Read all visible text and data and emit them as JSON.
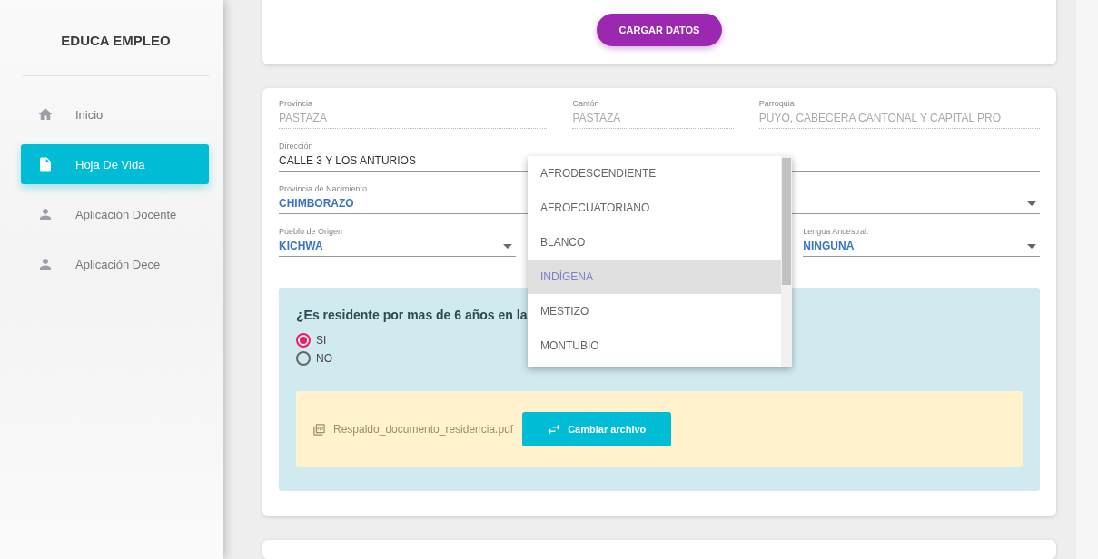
{
  "sidebar": {
    "title": "EDUCA EMPLEO",
    "items": [
      {
        "label": "Inicio",
        "kind": "home",
        "selected": false
      },
      {
        "label": "Hoja De Vida",
        "kind": "file",
        "selected": true
      },
      {
        "label": "Aplicación Docente",
        "kind": "person",
        "selected": false
      },
      {
        "label": "Aplicación Dece",
        "kind": "person",
        "selected": false
      }
    ]
  },
  "top_card": {
    "button": "CARGAR DATOS"
  },
  "form": {
    "rows": [
      [
        {
          "label": "Provincia",
          "value": "PASTAZA",
          "kind": "text",
          "disabled": true
        },
        {
          "label": "Cantón",
          "value": "PASTAZA",
          "kind": "text",
          "disabled": true
        },
        {
          "label": "Parroquia",
          "value": "PUYO, CABECERA CANTONAL Y CAPITAL PRO",
          "kind": "text",
          "disabled": true
        }
      ],
      [
        {
          "label": "Dirección",
          "value": "CALLE 3 Y LOS ANTURIOS",
          "kind": "text",
          "disabled": false
        }
      ],
      [
        {
          "label": "Provincia de Nacimiento",
          "value": "CHIMBORAZO",
          "kind": "select",
          "disabled": false
        }
      ],
      [
        {
          "label": "Pueblo de Origen",
          "value": "KICHWA",
          "kind": "select",
          "disabled": false
        },
        {
          "kind": "hidden"
        },
        {
          "label": "Lengua Ancestral:",
          "value": "NINGUNA",
          "kind": "select",
          "disabled": false
        }
      ]
    ],
    "dropdown": {
      "options": [
        {
          "label": "AFRODESCENDIENTE",
          "selected": false
        },
        {
          "label": "AFROECUATORIANO",
          "selected": false
        },
        {
          "label": "BLANCO",
          "selected": false
        },
        {
          "label": "INDÍGENA",
          "selected": true
        },
        {
          "label": "MESTIZO",
          "selected": false
        },
        {
          "label": "MONTUBIO",
          "selected": false
        }
      ]
    },
    "residence": {
      "question": "¿Es residente por mas de 6 años en la",
      "options": [
        {
          "label": "SI",
          "selected": true
        },
        {
          "label": "NO",
          "selected": false
        }
      ],
      "file_name": "Respaldo_documento_residencia.pdf",
      "button": "Cambiar archivo"
    }
  }
}
